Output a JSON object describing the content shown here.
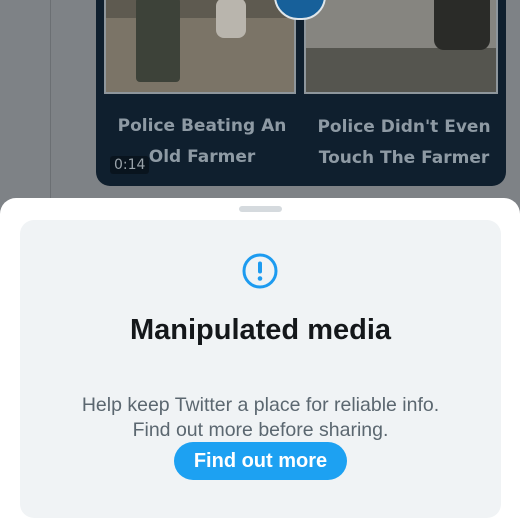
{
  "video": {
    "caption_left": "Police Beating An Old Farmer",
    "caption_right": "Police Didn't Even Touch The Farmer",
    "duration": "0:14",
    "play_icon": "play-icon"
  },
  "sheet": {
    "icon": "alert-circle-icon",
    "title": "Manipulated media",
    "body_line1": "Help keep Twitter a place for reliable info.",
    "body_line2": "Find out more before sharing.",
    "cta_label": "Find out more"
  },
  "colors": {
    "accent": "#1da1f2",
    "title_text": "#14171a",
    "body_text": "#5b6770",
    "card_background": "#f0f3f5",
    "dim_overlay": "#7e8286"
  }
}
